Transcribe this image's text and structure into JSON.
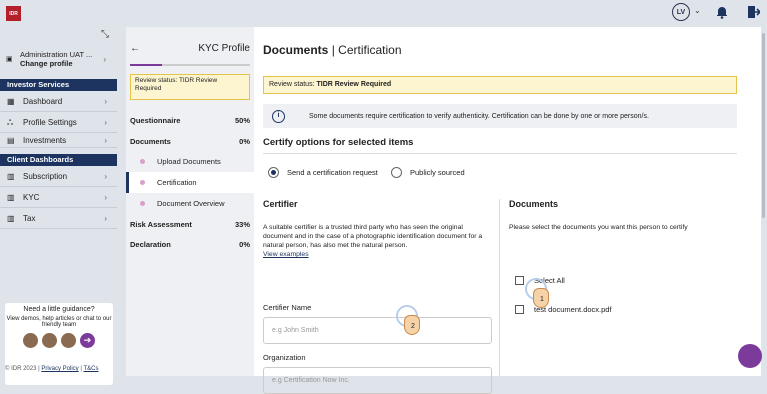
{
  "top": {
    "logo": "IDR",
    "avatar": "LV"
  },
  "sidebar": {
    "account_name": "Administration UAT ...",
    "change_profile": "Change profile",
    "sections": [
      {
        "title": "Investor Services",
        "items": [
          "Dashboard",
          "Profile Settings",
          "Investments"
        ]
      },
      {
        "title": "Client Dashboards",
        "items": [
          "Subscription",
          "KYC",
          "Tax"
        ]
      }
    ],
    "guidance": {
      "title": "Need a little guidance?",
      "text": "View demos, help articles or chat to our friendly team"
    },
    "footer": {
      "copy": "© IDR 2023 |",
      "privacy": "Privacy Policy",
      "sep": "|",
      "tcs": "T&Cs"
    }
  },
  "steps": {
    "title": "KYC Profile",
    "progress": 0.27,
    "review": "Review status: TIDR Review Required",
    "rows": [
      {
        "label": "Questionnaire",
        "value": "50%",
        "bold": true
      },
      {
        "label": "Documents",
        "value": "0%",
        "bold": true
      },
      {
        "label": "Upload Documents",
        "sub": true
      },
      {
        "label": "Certification",
        "sub": true,
        "active": true
      },
      {
        "label": "Document Overview",
        "sub": true
      },
      {
        "label": "Risk Assessment",
        "value": "33%",
        "bold": true
      },
      {
        "label": "Declaration",
        "value": "0%",
        "bold": true
      }
    ]
  },
  "main": {
    "title_bold": "Documents",
    "title_sep": "|",
    "title_rest": "Certification",
    "banner_prefix": "Review status: ",
    "banner_status": "TIDR Review Required",
    "info": "Some documents require certification to verify authenticity. Certification can be done by one or more person/s.",
    "certify_heading": "Certify options for selected items",
    "options": [
      "Send a certification request",
      "Publicly sourced"
    ],
    "certifier": {
      "heading": "Certifier",
      "desc": "A suitable certifier is a trusted third party who has seen the original document and in the case of a photographic identification document for a natural person, has also met the natural person.",
      "link": "View examples",
      "name_label": "Certifier Name",
      "name_placeholder": "e.g John Smith",
      "org_label": "Organization",
      "org_placeholder": "e.g Certification Now Inc."
    },
    "documents": {
      "heading": "Documents",
      "desc": "Please select the documents you want this person to certify",
      "select_all": "Select All",
      "doc": "test document.docx.pdf"
    }
  },
  "markers": [
    "1",
    "2"
  ]
}
